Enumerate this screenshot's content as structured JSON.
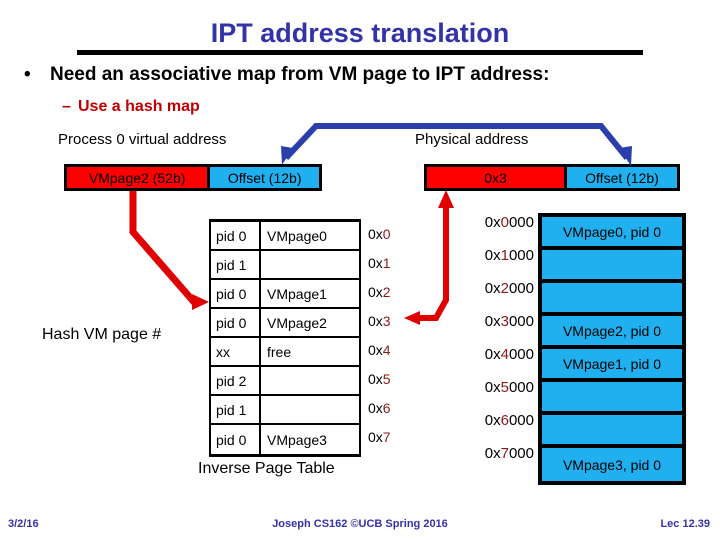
{
  "slide": {
    "title": "IPT address translation",
    "bullets": {
      "level1": "Need an associative map from VM page to IPT address:",
      "level1_marker": "•",
      "level2": "Use a hash map",
      "level2_marker": "–"
    },
    "captions": {
      "virtual_address": "Process 0 virtual address",
      "physical_address": "Physical address",
      "inverse_page_table": "Inverse Page Table",
      "hash_label": "Hash VM page #"
    },
    "virtual_address_bar": {
      "page_field": "VMpage2 (52b)",
      "offset_field": "Offset (12b)",
      "page_color": "#fe0000",
      "offset_color": "#20b0f0"
    },
    "physical_address_bar": {
      "frame_field": "0x3",
      "offset_field": "Offset (12b)",
      "frame_color": "#fe0000",
      "offset_color": "#20b0f0"
    },
    "ipt": {
      "rows": [
        {
          "pid": "pid 0",
          "page": "VMpage0",
          "index_prefix": "0x",
          "index_digit": "0"
        },
        {
          "pid": "pid 1",
          "page": "",
          "index_prefix": "0x",
          "index_digit": "1"
        },
        {
          "pid": "pid 0",
          "page": "VMpage1",
          "index_prefix": "0x",
          "index_digit": "2"
        },
        {
          "pid": "pid 0",
          "page": "VMpage2",
          "index_prefix": "0x",
          "index_digit": "3"
        },
        {
          "pid": "xx",
          "page": "free",
          "index_prefix": "0x",
          "index_digit": "4"
        },
        {
          "pid": "pid 2",
          "page": "",
          "index_prefix": "0x",
          "index_digit": "5"
        },
        {
          "pid": "pid 1",
          "page": "",
          "index_prefix": "0x",
          "index_digit": "6"
        },
        {
          "pid": "pid 0",
          "page": "VMpage3",
          "index_prefix": "0x",
          "index_digit": "7"
        }
      ]
    },
    "memory": {
      "blocks": [
        {
          "label": "VMpage0, pid 0"
        },
        {
          "label": ""
        },
        {
          "label": ""
        },
        {
          "label": "VMpage2, pid 0"
        },
        {
          "label": "VMpage1, pid 0"
        },
        {
          "label": ""
        },
        {
          "label": ""
        },
        {
          "label": "VMpage3, pid 0"
        }
      ],
      "addresses": [
        {
          "prefix": "0x",
          "digit": "0",
          "suffix": "000"
        },
        {
          "prefix": "0x",
          "digit": "1",
          "suffix": "000"
        },
        {
          "prefix": "0x",
          "digit": "2",
          "suffix": "000"
        },
        {
          "prefix": "0x",
          "digit": "3",
          "suffix": "000"
        },
        {
          "prefix": "0x",
          "digit": "4",
          "suffix": "000"
        },
        {
          "prefix": "0x",
          "digit": "5",
          "suffix": "000"
        },
        {
          "prefix": "0x",
          "digit": "6",
          "suffix": "000"
        },
        {
          "prefix": "0x",
          "digit": "7",
          "suffix": "000"
        }
      ]
    },
    "colors": {
      "title_blue": "#3333a8",
      "bullet_red": "#c00000",
      "arrow_red": "#e00000",
      "arrow_blue": "#2b3faa",
      "hex_digit_red": "#8b1a1a"
    },
    "footer": {
      "date": "3/2/16",
      "center": "Joseph CS162 ©UCB Spring 2016",
      "lecture": "Lec 12.39"
    }
  }
}
